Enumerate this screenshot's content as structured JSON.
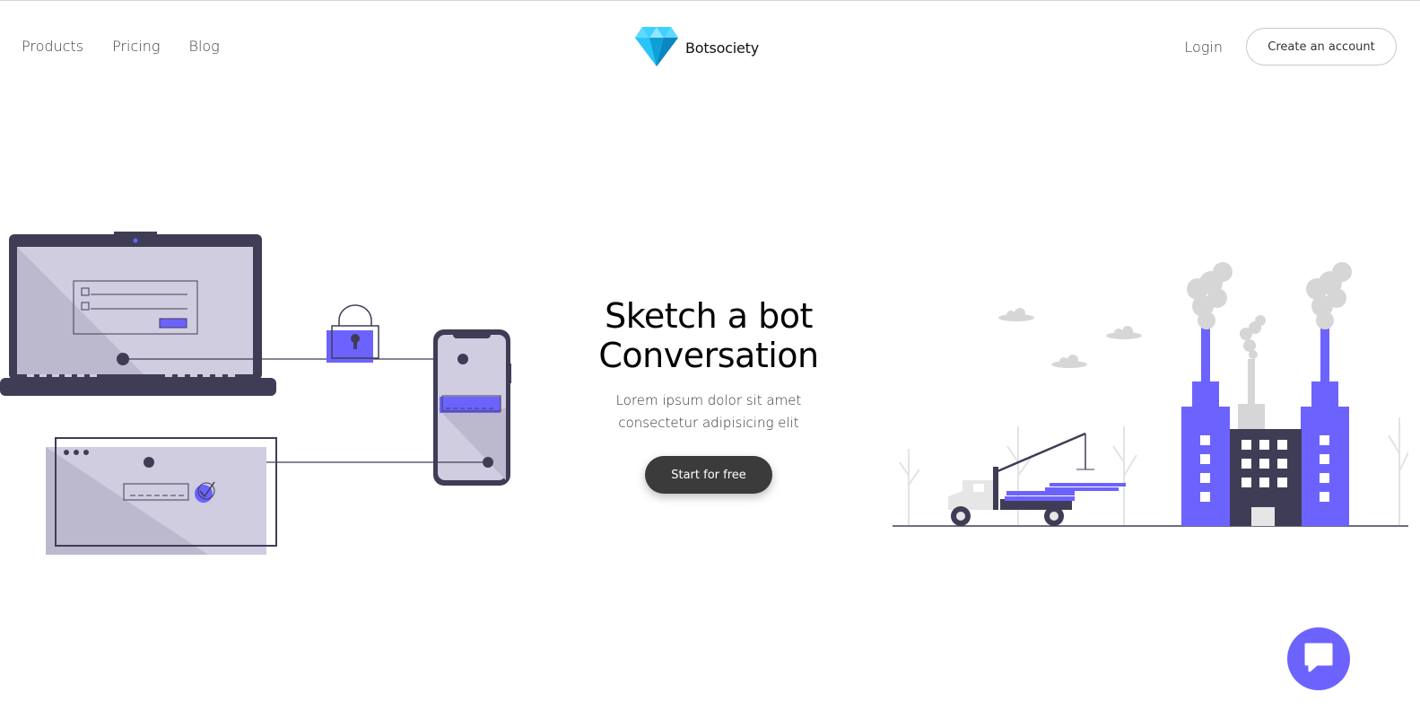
{
  "nav": {
    "links": [
      "Products",
      "Pricing",
      "Blog"
    ],
    "brand": "Botsociety",
    "login": "Login",
    "create_account": "Create an account"
  },
  "hero": {
    "title_line1": "Sketch a bot",
    "title_line2": "Conversation",
    "subtitle_line1": "Lorem ipsum dolor sit amet",
    "subtitle_line2": "consectetur adipisicing elit",
    "cta": "Start for free"
  },
  "colors": {
    "accent": "#6c63ff",
    "dark": "#3f3d56",
    "cta_bg": "#3b3b3b",
    "light_purple": "#d0cde1",
    "diamond": "#29c5f6"
  },
  "icons": [
    "diamond-logo-icon",
    "chat-bubble-icon"
  ]
}
